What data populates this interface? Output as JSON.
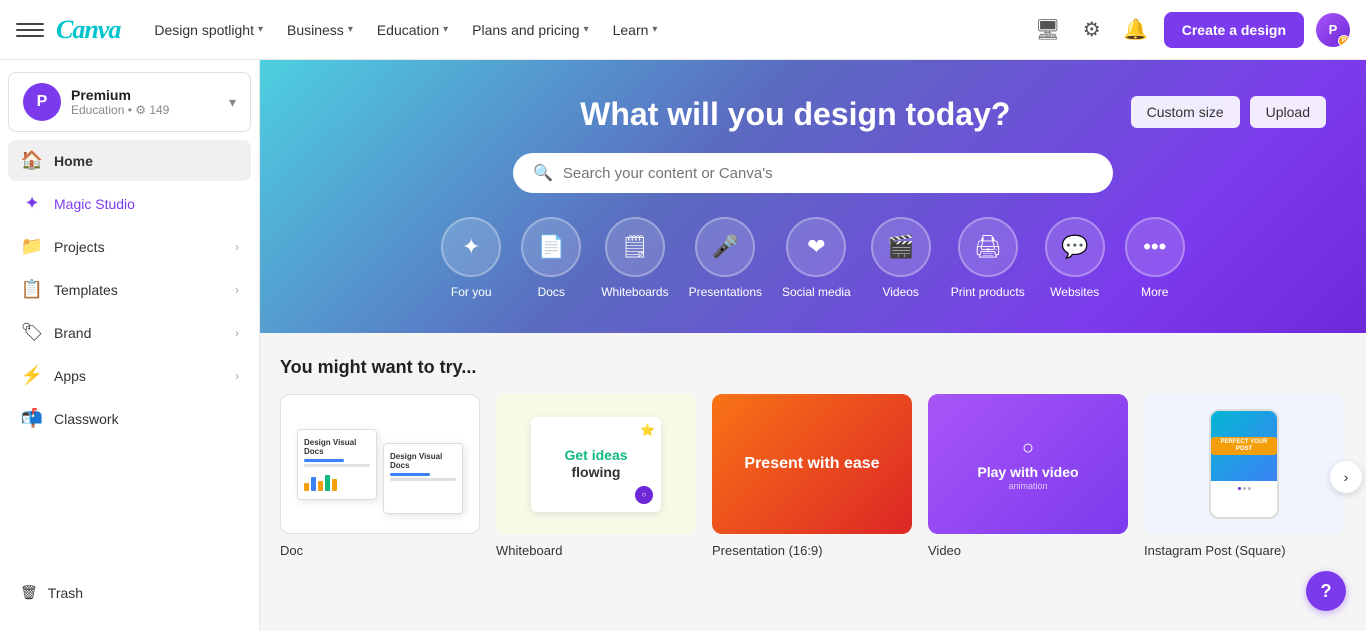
{
  "topnav": {
    "logo": "Canva",
    "nav_items": [
      {
        "label": "Design spotlight",
        "has_dropdown": true
      },
      {
        "label": "Business",
        "has_dropdown": true
      },
      {
        "label": "Education",
        "has_dropdown": true
      },
      {
        "label": "Plans and pricing",
        "has_dropdown": true
      },
      {
        "label": "Learn",
        "has_dropdown": true
      }
    ],
    "create_btn": "Create a design",
    "avatar_initials": "P"
  },
  "sidebar": {
    "profile": {
      "name": "Premium",
      "sub": "Education • ⚙ 149"
    },
    "avatar_letter": "P",
    "nav_items": [
      {
        "id": "home",
        "label": "Home",
        "icon": "🏠",
        "active": true
      },
      {
        "id": "magic-studio",
        "label": "Magic Studio",
        "icon": "✦",
        "magic": true
      },
      {
        "id": "projects",
        "label": "Projects",
        "icon": "📁",
        "has_chevron": true
      },
      {
        "id": "templates",
        "label": "Templates",
        "icon": "📋",
        "has_chevron": true
      },
      {
        "id": "brand",
        "label": "Brand",
        "icon": "🏷",
        "has_chevron": true
      },
      {
        "id": "apps",
        "label": "Apps",
        "icon": "⚡",
        "has_chevron": true
      },
      {
        "id": "classwork",
        "label": "Classwork",
        "icon": "📬"
      }
    ],
    "trash_label": "Trash"
  },
  "hero": {
    "title": "What will you design today?",
    "custom_size_btn": "Custom size",
    "upload_btn": "Upload",
    "search_placeholder": "Search your content or Canva's"
  },
  "categories": [
    {
      "id": "for-you",
      "icon": "✦",
      "label": "For you"
    },
    {
      "id": "docs",
      "icon": "📄",
      "label": "Docs"
    },
    {
      "id": "whiteboards",
      "icon": "📋",
      "label": "Whiteboards"
    },
    {
      "id": "presentations",
      "icon": "🎤",
      "label": "Presentations"
    },
    {
      "id": "social-media",
      "icon": "❤",
      "label": "Social media"
    },
    {
      "id": "videos",
      "icon": "🎬",
      "label": "Videos"
    },
    {
      "id": "print-products",
      "icon": "🖨",
      "label": "Print products"
    },
    {
      "id": "websites",
      "icon": "💬",
      "label": "Websites"
    },
    {
      "id": "more",
      "icon": "•••",
      "label": "More"
    }
  ],
  "suggestions": {
    "title": "You might want to try...",
    "cards": [
      {
        "id": "doc",
        "label": "Doc",
        "type": "doc"
      },
      {
        "id": "whiteboard",
        "label": "Whiteboard",
        "type": "whiteboard"
      },
      {
        "id": "presentation",
        "label": "Presentation (16:9)",
        "type": "presentation"
      },
      {
        "id": "video",
        "label": "Video",
        "type": "video"
      },
      {
        "id": "instagram",
        "label": "Instagram Post (Square)",
        "type": "instagram"
      }
    ]
  },
  "help_btn": "?",
  "card_texts": {
    "doc_title": "Design Visual Docs",
    "whiteboard_title": "Get ideas flowing",
    "presentation_title": "Present with ease",
    "video_title": "Play with video",
    "video_sub": "animation",
    "instagram_badge": "PERFECT YOUR POST"
  }
}
